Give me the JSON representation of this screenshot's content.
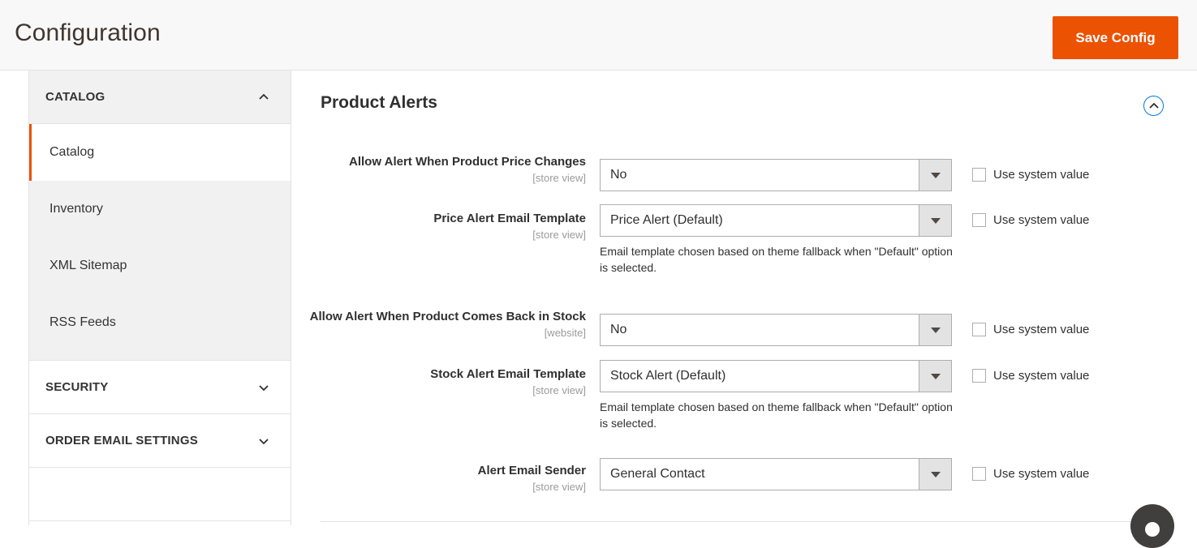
{
  "header": {
    "title": "Configuration",
    "save_label": "Save Config"
  },
  "sidebar": {
    "sections": [
      {
        "label": "CATALOG",
        "expanded": true,
        "icon": "chevron-up-icon",
        "items": [
          {
            "label": "Catalog",
            "active": true
          },
          {
            "label": "Inventory",
            "active": false
          },
          {
            "label": "XML Sitemap",
            "active": false
          },
          {
            "label": "RSS Feeds",
            "active": false
          }
        ]
      },
      {
        "label": "SECURITY",
        "expanded": false,
        "icon": "chevron-down-icon",
        "items": []
      },
      {
        "label": "ORDER EMAIL SETTINGS",
        "expanded": false,
        "icon": "chevron-down-icon",
        "items": []
      }
    ]
  },
  "content": {
    "group_title": "Product Alerts",
    "collapse_icon": "chevron-up-circle-icon",
    "system_value_label": "Use system value",
    "email_template_note": "Email template chosen based on theme fallback when \"Default\" option is selected.",
    "fields": [
      {
        "label": "Allow Alert When Product Price Changes",
        "scope": "[store view]",
        "value": "No",
        "use_system_value": false
      },
      {
        "label": "Price Alert Email Template",
        "scope": "[store view]",
        "value": "Price Alert (Default)",
        "use_system_value": false
      },
      {
        "label": "Allow Alert When Product Comes Back in Stock",
        "scope": "[website]",
        "value": "No",
        "use_system_value": false
      },
      {
        "label": "Stock Alert Email Template",
        "scope": "[store view]",
        "value": "Stock Alert (Default)",
        "use_system_value": false
      },
      {
        "label": "Alert Email Sender",
        "scope": "[store view]",
        "value": "General Contact",
        "use_system_value": false
      }
    ]
  },
  "help_bubble": {
    "icon": "help-chat-icon"
  },
  "colors": {
    "accent_orange": "#eb5202",
    "header_bg": "#f8f8f8",
    "sidebar_sub_bg": "#f1f1f1",
    "border": "#e3e3e3",
    "text": "#303030",
    "scope_text": "#9b9b9b",
    "select_arrow_bg": "#e3e3e3",
    "link_blue": "#007bdb"
  }
}
